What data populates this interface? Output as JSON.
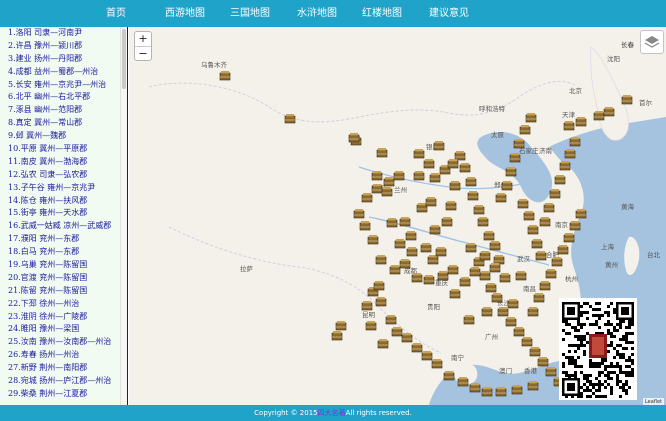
{
  "nav": {
    "items": [
      "首页",
      "西游地图",
      "三国地图",
      "水浒地图",
      "红楼地图",
      "建议意见"
    ]
  },
  "sidebar": {
    "items": [
      "1.洛阳 司隶—河南尹",
      "2.许昌 豫州—颍川郡",
      "3.建业 扬州—丹阳郡",
      "4.成都 益州—蜀郡—州治",
      "5.长安 雍州—京兆尹—州治",
      "6.北平 幽州—右北平郡",
      "7.涿县 幽州—范阳郡",
      "8.真定 冀州—常山郡",
      "9.邺 冀州—魏郡",
      "10.平原 冀州—平原郡",
      "11.南皮 冀州—渤海郡",
      "12.弘农 司隶—弘农郡",
      "13.子午谷 雍州—京兆尹",
      "14.陈仓 雍州—扶风郡",
      "15.街亭 雍州—天水郡",
      "16.武威一姑臧 凉州—武威郡",
      "17.濮阳 兖州—东郡",
      "18.白马 兖州—东郡",
      "19.乌巢 兖州—陈留国",
      "20.官渡 兖州—陈留国",
      "21.陈留 兖州—陈留国",
      "22.下邳 徐州—州治",
      "23.淮阴 徐州—广陵郡",
      "24.睢阳 豫州—梁国",
      "25.汝南 豫州—汝南郡—州治",
      "26.寿春 扬州—州治",
      "27.新野 荆州—南阳郡",
      "28.宛城 扬州—庐江郡—州治",
      "29.柴桑 荆州—江夏郡"
    ]
  },
  "map": {
    "zoom_in": "+",
    "zoom_out": "−",
    "labels": [
      "乌鲁木齐",
      "呼和浩特",
      "银川",
      "西宁",
      "兰州",
      "拉萨",
      "成都",
      "重庆",
      "贵阳",
      "昆明",
      "南宁",
      "广州",
      "澳门",
      "香港",
      "长沙",
      "武汉",
      "南昌",
      "合肥",
      "南京",
      "上海",
      "杭州",
      "福州",
      "台北",
      "郑州",
      "太原",
      "石家庄",
      "北京",
      "天津",
      "沈阳",
      "长春",
      "长春",
      "济南",
      "首尔",
      "黄海",
      "黄州"
    ],
    "attribution": "Leaflet"
  },
  "footer": {
    "prefix": "Copyright © 2015",
    "brand": "四大名著",
    "suffix": "All rights reserved."
  },
  "colors": {
    "nav_bar": "#1fa3c8",
    "sidebar_bg": "#f1fbf1",
    "sidebar_text": "#1a1aa0",
    "sea": "#a5c2df",
    "land": "#f4f1ea",
    "marker": "#8a6a2e"
  }
}
